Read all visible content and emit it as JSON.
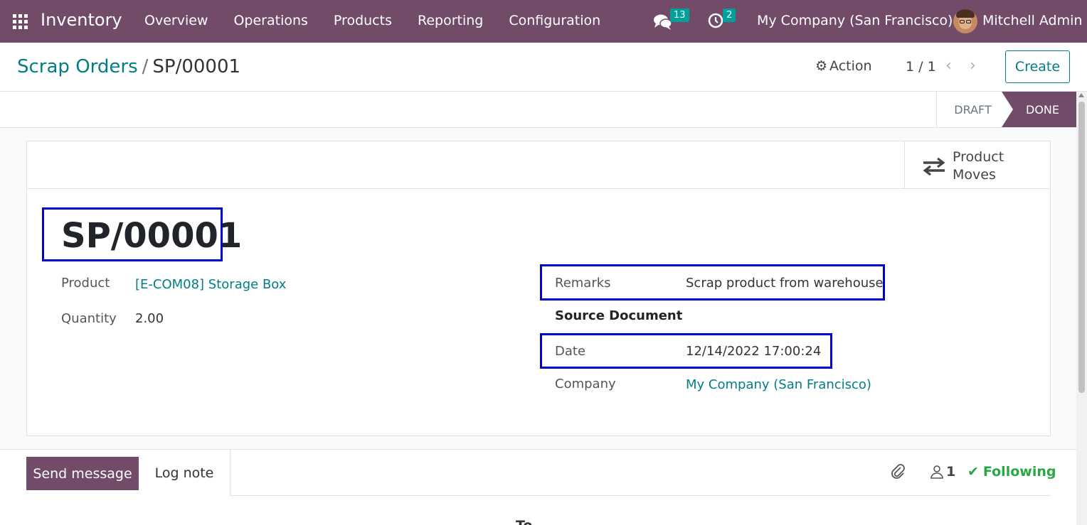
{
  "navbar": {
    "app_name": "Inventory",
    "menu": [
      "Overview",
      "Operations",
      "Products",
      "Reporting",
      "Configuration"
    ],
    "messages_count": "13",
    "activities_count": "2",
    "company": "My Company (San Francisco)",
    "user": "Mitchell Admin"
  },
  "breadcrumb": {
    "parent": "Scrap Orders",
    "separator": "/",
    "current": "SP/00001"
  },
  "control": {
    "action_label": "Action",
    "pager": "1 / 1",
    "create_label": "Create"
  },
  "statusbar": {
    "stages": [
      "DRAFT",
      "DONE"
    ],
    "active_stage": "DONE"
  },
  "smart_buttons": {
    "product_moves_line1": "Product",
    "product_moves_line2": "Moves"
  },
  "record": {
    "name": "SP/00001",
    "fields_left": [
      {
        "label": "Product",
        "value": "[E-COM08] Storage Box"
      },
      {
        "label": "Quantity",
        "value": "2.00"
      }
    ],
    "fields_right": [
      {
        "label": "Remarks",
        "value": "Scrap product from warehouse"
      },
      {
        "label": "Source Document",
        "value": ""
      },
      {
        "label": "Date",
        "value": "12/14/2022 17:00:24"
      },
      {
        "label": "Company",
        "value": "My Company (San Francisco)"
      }
    ]
  },
  "chatter": {
    "send_message": "Send message",
    "log_note": "Log note",
    "followers_count": "1",
    "following": "Following",
    "today_partial": "To"
  },
  "colors": {
    "brand": "#714b67",
    "link": "#017e84",
    "highlight": "#0000d0",
    "badge": "#00a09d",
    "following": "#28a745"
  }
}
